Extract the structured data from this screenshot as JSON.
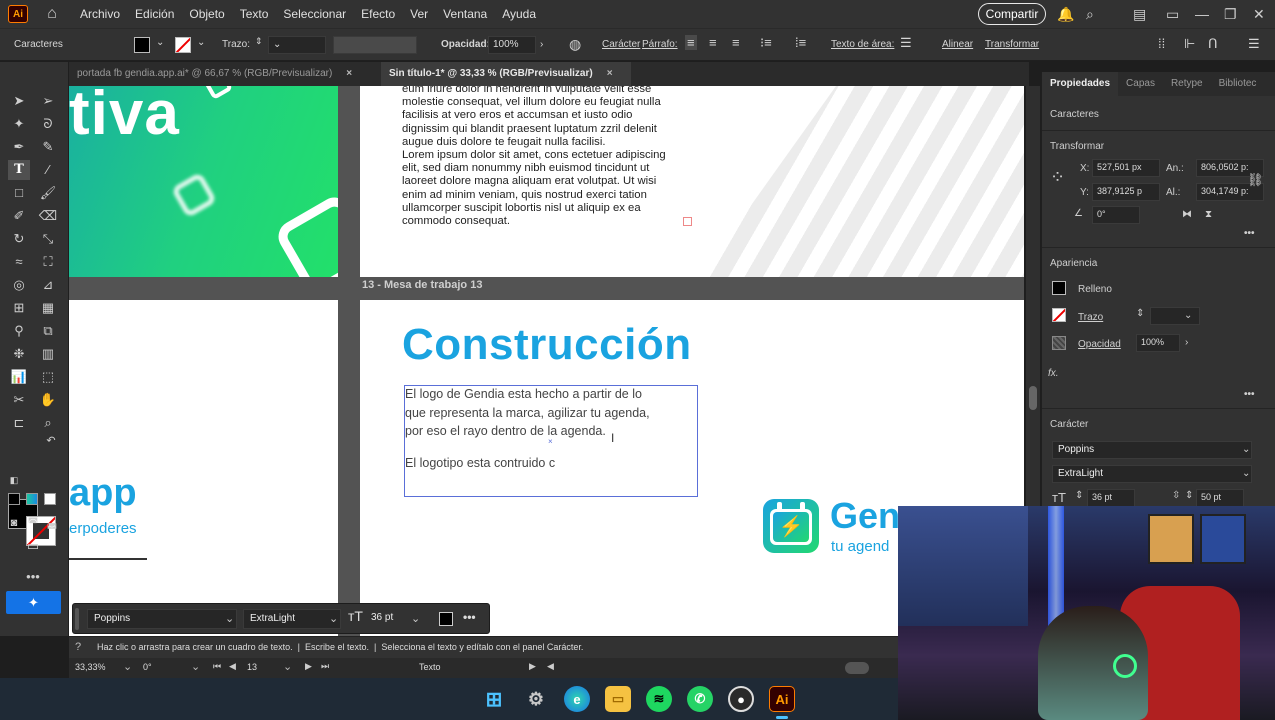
{
  "app": {
    "logo": "Ai",
    "menu": [
      "Archivo",
      "Edición",
      "Objeto",
      "Texto",
      "Seleccionar",
      "Efecto",
      "Ver",
      "Ventana",
      "Ayuda"
    ],
    "share_label": "Compartir"
  },
  "controlbar": {
    "section": "Caracteres",
    "stroke_label": "Trazo:",
    "opacity_label": "Opacidad:",
    "opacity_value": "100%",
    "character_link": "Carácter",
    "paragraph_link": "Párrafo:",
    "textarea_label": "Texto de área:",
    "align_label": "Alinear",
    "transform_label": "Transformar"
  },
  "tabs": [
    {
      "label": "portada fb gendia.app.ai* @ 66,67 % (RGB/Previsualizar)",
      "close": "×"
    },
    {
      "label": "Sin título-1* @ 33,33 % (RGB/Previsualizar)",
      "close": "×"
    }
  ],
  "canvas": {
    "big_word": "tiva",
    "app_word": "app",
    "app_sub": "erpoderes",
    "lorem_lines": [
      "eum iriure dolor in hendrerit in vulputate velit esse",
      "molestie consequat, vel illum dolore eu feugiat nulla",
      "facilisis at vero eros et accumsan et iusto odio",
      "dignissim qui blandit praesent luptatum zzril delenit",
      "augue duis dolore te feugait nulla facilisi.",
      "Lorem ipsum dolor sit amet, cons ectetuer adipiscing",
      "elit, sed diam nonummy nibh euismod tincidunt ut",
      "laoreet dolore magna aliquam erat volutpat. Ut wisi",
      "enim ad minim veniam, quis nostrud exerci tation",
      "ullamcorper suscipit lobortis nisl ut aliquip ex ea",
      "commodo consequat."
    ],
    "artboard_label": "13 - Mesa de trabajo 13",
    "heading": "Construcción",
    "para1_lines": [
      "El logo de Gendia esta hecho a partir de lo",
      "que representa la marca, agilizar tu agenda,",
      "por eso el rayo dentro de la agenda."
    ],
    "para2": "El logotipo esta contruido c",
    "logo_word": "Gen",
    "logo_tagline": "tu agend"
  },
  "rightpanel": {
    "tabs": [
      "Propiedades",
      "Capas",
      "Retype",
      "Bibliotec"
    ],
    "caracteres": "Caracteres",
    "transformar": "Transformar",
    "x_label": "X:",
    "x_value": "527,501 px",
    "y_label": "Y:",
    "y_value": "387,9125 p",
    "w_label": "An.:",
    "w_value": "806,0502 p:",
    "h_label": "Al.:",
    "h_value": "304,1749 p:",
    "angle_value": "0°",
    "apariencia": "Apariencia",
    "relleno": "Relleno",
    "trazo": "Trazo",
    "opacidad": "Opacidad",
    "opacidad_value": "100%",
    "fx": "fx.",
    "caracter": "Carácter",
    "font_family": "Poppins",
    "font_style": "ExtraLight",
    "font_size": "36 pt",
    "leading": "50 pt"
  },
  "textbar": {
    "font_family": "Poppins",
    "font_style": "ExtraLight",
    "font_size": "36 pt"
  },
  "status": {
    "hint1": "Haz clic o arrastra para crear un cuadro de texto.",
    "hint2": "Escribe el texto.",
    "hint3": "Selecciona el texto y edítalo con el panel Carácter.",
    "zoom": "33,33%",
    "rotation": "0°",
    "artboard_num": "13",
    "tool_name": "Texto"
  },
  "colors": {
    "brand_blue": "#1aa3e0",
    "brand_green": "#22e06a",
    "panel_bg": "#323232",
    "canvas_bg": "#535353"
  }
}
